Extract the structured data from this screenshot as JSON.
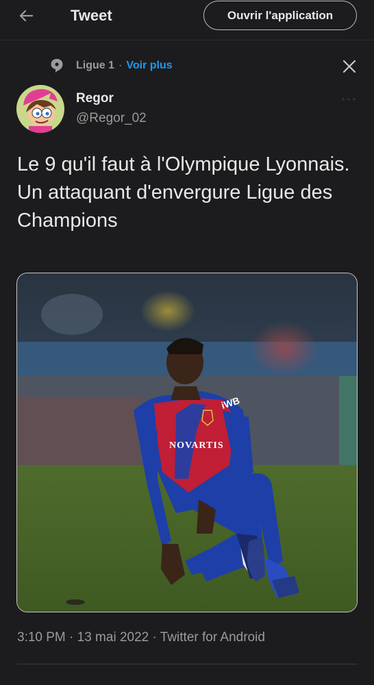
{
  "header": {
    "title": "Tweet",
    "open_app_label": "Ouvrir l'application"
  },
  "context": {
    "topic": "Ligue 1",
    "separator": "·",
    "see_more": "Voir plus"
  },
  "author": {
    "name": "Regor",
    "handle": "@Regor_02"
  },
  "tweet": {
    "text": "Le 9 qu'il faut à l'Olympique Lyonnais. Un attaquant d'envergure Ligue des Champions",
    "meta": "3:10 PM · 13 mai 2022 · Twitter for Android"
  },
  "media": {
    "jersey_sponsor": "NOVARTIS",
    "kit_brand": "iWB"
  },
  "icons": {
    "back": "arrow-left-icon",
    "topic": "topic-pin-icon",
    "close": "close-icon",
    "more": "more-dots-icon"
  },
  "colors": {
    "background": "#1c1c1e",
    "accent": "#1d9bf0",
    "secondary_text": "#9b9b9b"
  }
}
